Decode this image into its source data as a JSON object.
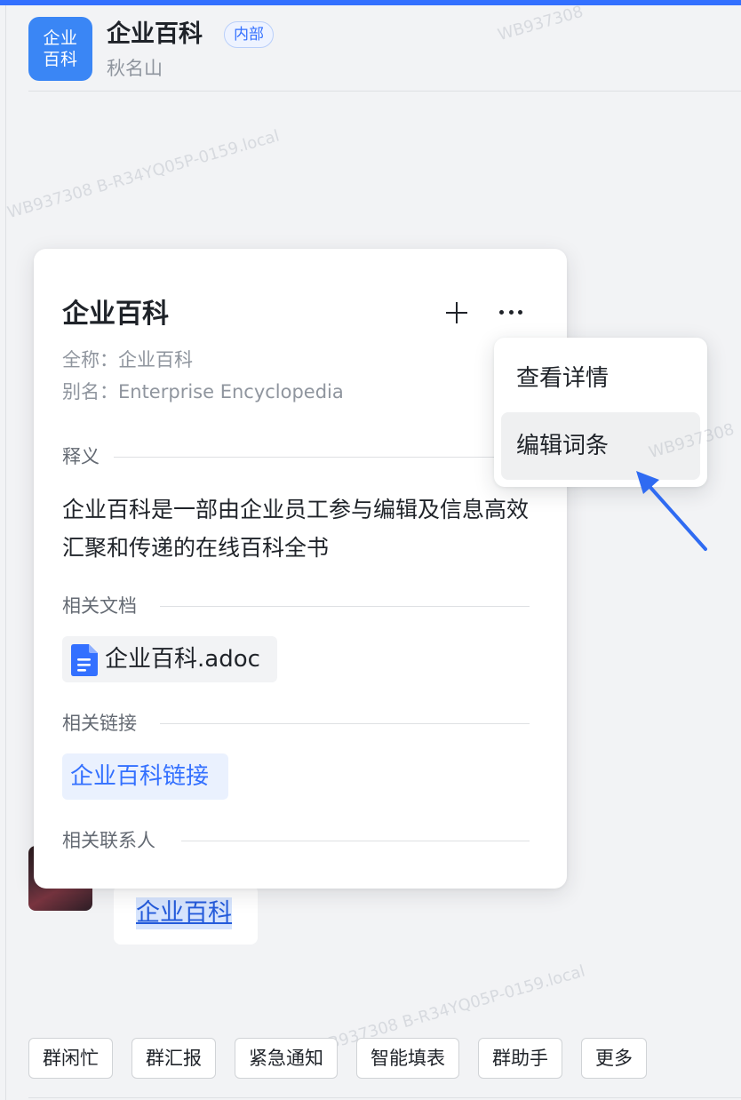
{
  "header": {
    "avatar_line1": "企业",
    "avatar_line2": "百科",
    "title": "企业百科",
    "badge": "内部",
    "subtitle": "秋名山"
  },
  "watermarks": [
    "WB937308 B-R34YQ05P-0159.local",
    "WB937308",
    "WB937308 B-R34YQ05P-0159.local",
    "WB937308 B-R34YQ05P-0159.local",
    "WB937308 B-R34YQ05P-0159.local"
  ],
  "card": {
    "title": "企业百科",
    "full_name": "全称：企业百科",
    "alias": "别名：Enterprise Encyclopedia",
    "definition_label": "释义",
    "definition": "企业百科是一部由企业员工参与编辑及信息高效汇聚和传递的在线百科全书",
    "docs_label": "相关文档",
    "doc_name": "企业百科.adoc",
    "links_label": "相关链接",
    "link_text": "企业百科链接",
    "contacts_label": "相关联系人"
  },
  "menu": {
    "items": [
      {
        "label": "查看详情"
      },
      {
        "label": "编辑词条"
      }
    ]
  },
  "message": {
    "link_text": "企业百科"
  },
  "quick_actions": [
    "群闲忙",
    "群汇报",
    "紧急通知",
    "智能填表",
    "群助手",
    "更多"
  ],
  "colors": {
    "accent": "#3370ff",
    "arrow": "#2f6bf2"
  }
}
